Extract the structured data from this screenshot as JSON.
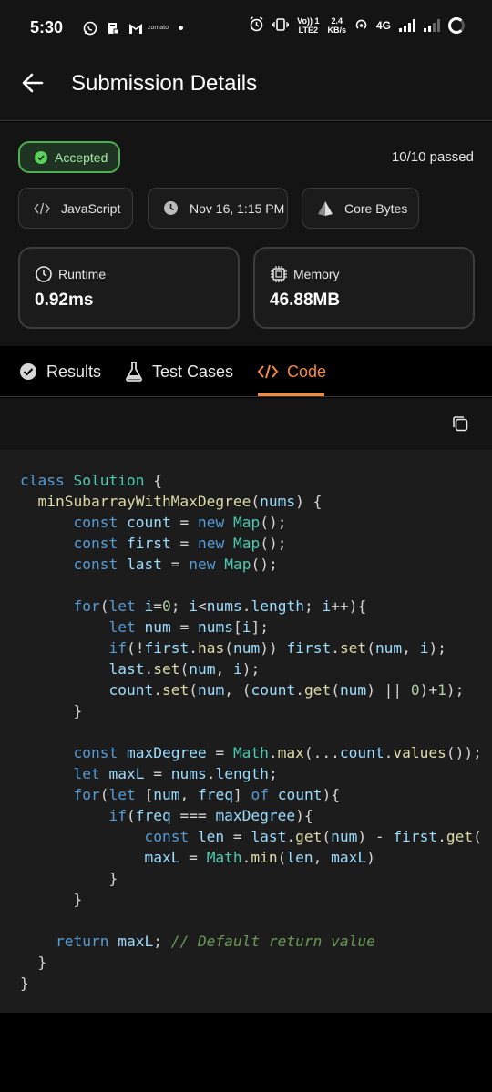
{
  "status_bar": {
    "time": "5:30",
    "zomato_label": "zomato",
    "net_label_top": "Vo)) 1",
    "net_label_bottom": "LTE2",
    "speed_top": "2.4",
    "speed_bottom": "KB/s",
    "network_type": "4G"
  },
  "header": {
    "title": "Submission Details"
  },
  "summary": {
    "status": "Accepted",
    "passed_text": "10/10 passed",
    "language": "JavaScript",
    "date": "Nov 16, 1:15 PM",
    "author": "Core Bytes",
    "runtime_label": "Runtime",
    "runtime_value": "0.92ms",
    "memory_label": "Memory",
    "memory_value": "46.88MB"
  },
  "tabs": [
    {
      "label": "Results"
    },
    {
      "label": "Test Cases"
    },
    {
      "label": "Code"
    }
  ],
  "active_tab": "Code",
  "accent_color": "#f58a42",
  "success_color": "#4caf50",
  "code_lines": [
    [
      [
        "kw",
        "class"
      ],
      [
        "op",
        " "
      ],
      [
        "cls",
        "Solution"
      ],
      [
        "op",
        " {"
      ]
    ],
    [
      [
        "op",
        "  "
      ],
      [
        "fn",
        "minSubarrayWithMaxDegree"
      ],
      [
        "op",
        "("
      ],
      [
        "var",
        "nums"
      ],
      [
        "op",
        ") {"
      ]
    ],
    [
      [
        "op",
        "      "
      ],
      [
        "kw",
        "const"
      ],
      [
        "op",
        " "
      ],
      [
        "var",
        "count"
      ],
      [
        "op",
        " = "
      ],
      [
        "kw",
        "new"
      ],
      [
        "op",
        " "
      ],
      [
        "cls",
        "Map"
      ],
      [
        "op",
        "();"
      ]
    ],
    [
      [
        "op",
        "      "
      ],
      [
        "kw",
        "const"
      ],
      [
        "op",
        " "
      ],
      [
        "var",
        "first"
      ],
      [
        "op",
        " = "
      ],
      [
        "kw",
        "new"
      ],
      [
        "op",
        " "
      ],
      [
        "cls",
        "Map"
      ],
      [
        "op",
        "();"
      ]
    ],
    [
      [
        "op",
        "      "
      ],
      [
        "kw",
        "const"
      ],
      [
        "op",
        " "
      ],
      [
        "var",
        "last"
      ],
      [
        "op",
        " = "
      ],
      [
        "kw",
        "new"
      ],
      [
        "op",
        " "
      ],
      [
        "cls",
        "Map"
      ],
      [
        "op",
        "();"
      ]
    ],
    [],
    [
      [
        "op",
        "      "
      ],
      [
        "kw",
        "for"
      ],
      [
        "op",
        "("
      ],
      [
        "kw",
        "let"
      ],
      [
        "op",
        " "
      ],
      [
        "var",
        "i"
      ],
      [
        "op",
        "="
      ],
      [
        "num",
        "0"
      ],
      [
        "op",
        "; "
      ],
      [
        "var",
        "i"
      ],
      [
        "op",
        "<"
      ],
      [
        "var",
        "nums"
      ],
      [
        "op",
        "."
      ],
      [
        "var",
        "length"
      ],
      [
        "op",
        "; "
      ],
      [
        "var",
        "i"
      ],
      [
        "op",
        "++){"
      ]
    ],
    [
      [
        "op",
        "          "
      ],
      [
        "kw",
        "let"
      ],
      [
        "op",
        " "
      ],
      [
        "var",
        "num"
      ],
      [
        "op",
        " = "
      ],
      [
        "var",
        "nums"
      ],
      [
        "op",
        "["
      ],
      [
        "var",
        "i"
      ],
      [
        "op",
        "];"
      ]
    ],
    [
      [
        "op",
        "          "
      ],
      [
        "kw",
        "if"
      ],
      [
        "op",
        "(!"
      ],
      [
        "var",
        "first"
      ],
      [
        "op",
        "."
      ],
      [
        "fn",
        "has"
      ],
      [
        "op",
        "("
      ],
      [
        "var",
        "num"
      ],
      [
        "op",
        ")) "
      ],
      [
        "var",
        "first"
      ],
      [
        "op",
        "."
      ],
      [
        "fn",
        "set"
      ],
      [
        "op",
        "("
      ],
      [
        "var",
        "num"
      ],
      [
        "op",
        ", "
      ],
      [
        "var",
        "i"
      ],
      [
        "op",
        ");"
      ]
    ],
    [
      [
        "op",
        "          "
      ],
      [
        "var",
        "last"
      ],
      [
        "op",
        "."
      ],
      [
        "fn",
        "set"
      ],
      [
        "op",
        "("
      ],
      [
        "var",
        "num"
      ],
      [
        "op",
        ", "
      ],
      [
        "var",
        "i"
      ],
      [
        "op",
        ");"
      ]
    ],
    [
      [
        "op",
        "          "
      ],
      [
        "var",
        "count"
      ],
      [
        "op",
        "."
      ],
      [
        "fn",
        "set"
      ],
      [
        "op",
        "("
      ],
      [
        "var",
        "num"
      ],
      [
        "op",
        ", ("
      ],
      [
        "var",
        "count"
      ],
      [
        "op",
        "."
      ],
      [
        "fn",
        "get"
      ],
      [
        "op",
        "("
      ],
      [
        "var",
        "num"
      ],
      [
        "op",
        ") || "
      ],
      [
        "num",
        "0"
      ],
      [
        "op",
        ")+"
      ],
      [
        "num",
        "1"
      ],
      [
        "op",
        ");"
      ]
    ],
    [
      [
        "op",
        "      }"
      ]
    ],
    [],
    [
      [
        "op",
        "      "
      ],
      [
        "kw",
        "const"
      ],
      [
        "op",
        " "
      ],
      [
        "var",
        "maxDegree"
      ],
      [
        "op",
        " = "
      ],
      [
        "cls",
        "Math"
      ],
      [
        "op",
        "."
      ],
      [
        "fn",
        "max"
      ],
      [
        "op",
        "(..."
      ],
      [
        "var",
        "count"
      ],
      [
        "op",
        "."
      ],
      [
        "fn",
        "values"
      ],
      [
        "op",
        "());"
      ]
    ],
    [
      [
        "op",
        "      "
      ],
      [
        "kw",
        "let"
      ],
      [
        "op",
        " "
      ],
      [
        "var",
        "maxL"
      ],
      [
        "op",
        " = "
      ],
      [
        "var",
        "nums"
      ],
      [
        "op",
        "."
      ],
      [
        "var",
        "length"
      ],
      [
        "op",
        ";"
      ]
    ],
    [
      [
        "op",
        "      "
      ],
      [
        "kw",
        "for"
      ],
      [
        "op",
        "("
      ],
      [
        "kw",
        "let"
      ],
      [
        "op",
        " ["
      ],
      [
        "var",
        "num"
      ],
      [
        "op",
        ", "
      ],
      [
        "var",
        "freq"
      ],
      [
        "op",
        "] "
      ],
      [
        "kw",
        "of"
      ],
      [
        "op",
        " "
      ],
      [
        "var",
        "count"
      ],
      [
        "op",
        "){"
      ]
    ],
    [
      [
        "op",
        "          "
      ],
      [
        "kw",
        "if"
      ],
      [
        "op",
        "("
      ],
      [
        "var",
        "freq"
      ],
      [
        "op",
        " === "
      ],
      [
        "var",
        "maxDegree"
      ],
      [
        "op",
        "){"
      ]
    ],
    [
      [
        "op",
        "              "
      ],
      [
        "kw",
        "const"
      ],
      [
        "op",
        " "
      ],
      [
        "var",
        "len"
      ],
      [
        "op",
        " = "
      ],
      [
        "var",
        "last"
      ],
      [
        "op",
        "."
      ],
      [
        "fn",
        "get"
      ],
      [
        "op",
        "("
      ],
      [
        "var",
        "num"
      ],
      [
        "op",
        ") - "
      ],
      [
        "var",
        "first"
      ],
      [
        "op",
        "."
      ],
      [
        "fn",
        "get"
      ],
      [
        "op",
        "("
      ]
    ],
    [
      [
        "op",
        "              "
      ],
      [
        "var",
        "maxL"
      ],
      [
        "op",
        " = "
      ],
      [
        "cls",
        "Math"
      ],
      [
        "op",
        "."
      ],
      [
        "fn",
        "min"
      ],
      [
        "op",
        "("
      ],
      [
        "var",
        "len"
      ],
      [
        "op",
        ", "
      ],
      [
        "var",
        "maxL"
      ],
      [
        "op",
        ")"
      ]
    ],
    [
      [
        "op",
        "          }"
      ]
    ],
    [
      [
        "op",
        "      }"
      ]
    ],
    [],
    [
      [
        "op",
        "    "
      ],
      [
        "kw",
        "return"
      ],
      [
        "op",
        " "
      ],
      [
        "var",
        "maxL"
      ],
      [
        "op",
        "; "
      ],
      [
        "cmt",
        "// Default return value"
      ]
    ],
    [
      [
        "op",
        "  }"
      ]
    ],
    [
      [
        "op",
        "}"
      ]
    ]
  ]
}
